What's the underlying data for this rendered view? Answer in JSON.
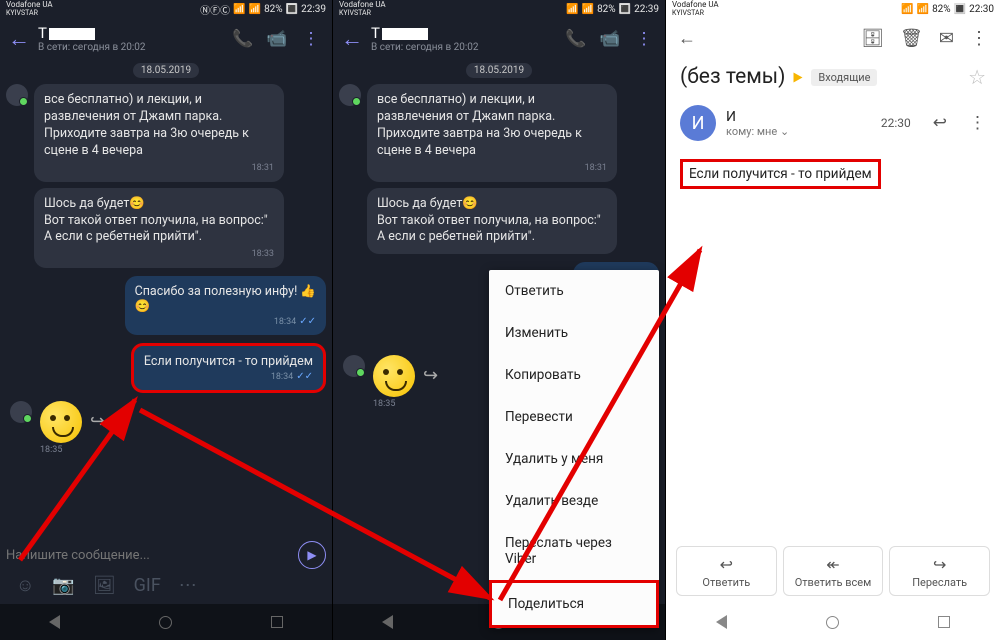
{
  "status": {
    "carrier": "Vodafone UA",
    "sub": "KYIVSTAR",
    "battery": "82%",
    "time": "22:39",
    "time_gmail": "22:30"
  },
  "viber": {
    "contact_name": "Т",
    "contact_status": "В сети: сегодня в 20:02",
    "date": "18.05.2019",
    "msg1": "все бесплатно) и лекции, и развлечения от Джамп парка. Приходите завтра на 3ю очередь к сцене в 4 вечера",
    "msg1_time": "18:31",
    "msg2a": "Шось да будет",
    "msg2b": "Вот такой ответ получила, на вопрос:\" А если с ребетней прийти\".",
    "msg2_time": "18:33",
    "msg3": "Спасибо за полезную инфу!",
    "msg3_time": "18:34",
    "msg4": "Если получится - то прийдем",
    "msg4_time": "18:34",
    "sticker_time": "18:35",
    "composer_placeholder": "Напишите сообщение..."
  },
  "viber2": {
    "msg3_short": "Спасибо за",
    "msg4_short": "Если п"
  },
  "ctx": {
    "reply": "Ответить",
    "edit": "Изменить",
    "copy": "Копировать",
    "translate": "Перевести",
    "delete_me": "Удалить у меня",
    "delete_all": "Удалить везде",
    "fwd_viber": "Переслать через Viber",
    "share": "Поделиться"
  },
  "gmail": {
    "subject": "(без темы)",
    "inbox_tag": "Входящие",
    "from_initial": "И",
    "from_name": "И",
    "to": "кому: мне",
    "msg_time": "22:30",
    "body": "Если получится - то прийдем",
    "act_reply": "Ответить",
    "act_reply_all": "Ответить всем",
    "act_fwd": "Переслать"
  }
}
